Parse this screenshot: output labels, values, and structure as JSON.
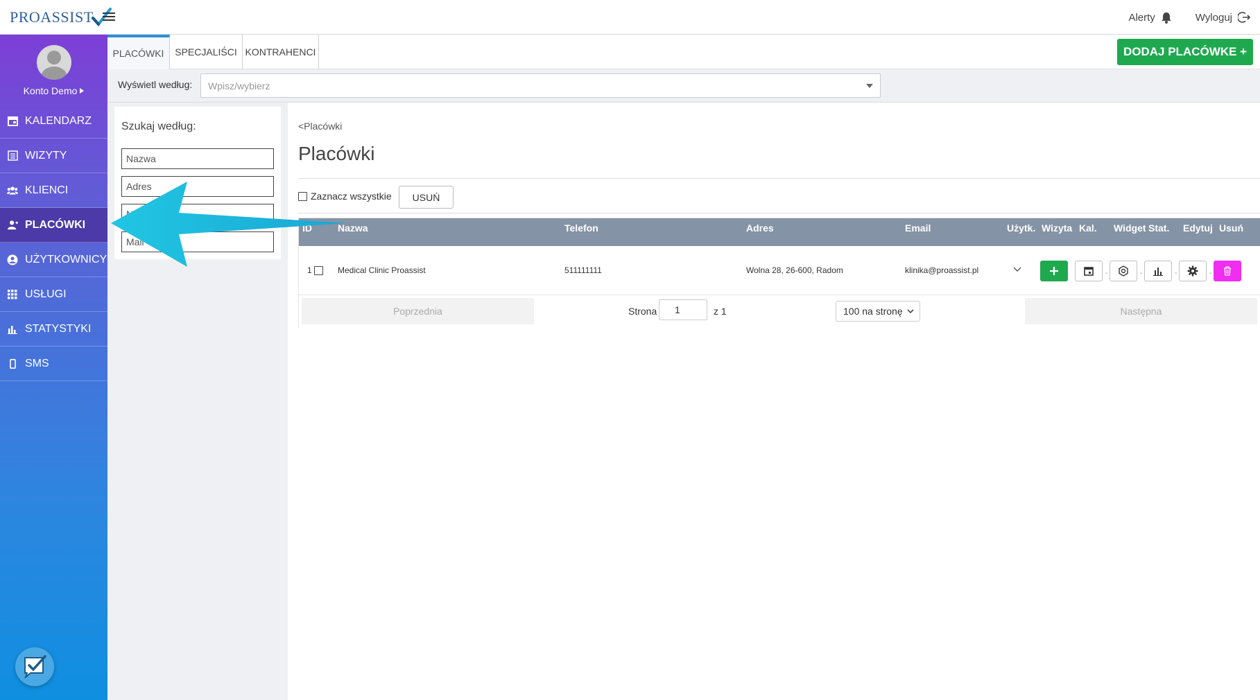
{
  "topbar": {
    "logo_text": "PROASSIST",
    "alerts_label": "Alerty",
    "logout_label": "Wyloguj"
  },
  "sidebar": {
    "profile_name": "Konto Demo",
    "items": [
      {
        "label": "KALENDARZ",
        "icon": "calendar-icon"
      },
      {
        "label": "WIZYTY",
        "icon": "list-icon"
      },
      {
        "label": "KLIENCI",
        "icon": "users-icon"
      },
      {
        "label": "PLACÓWKI",
        "icon": "user-icon",
        "active": true
      },
      {
        "label": "UŻYTKOWNICY",
        "icon": "user-circle-icon"
      },
      {
        "label": "USŁUGI",
        "icon": "grid-icon"
      },
      {
        "label": "STATYSTYKI",
        "icon": "chart-icon"
      },
      {
        "label": "SMS",
        "icon": "phone-icon"
      }
    ]
  },
  "tabs": [
    {
      "label": "PLACÓWKI",
      "active": true
    },
    {
      "label": "SPECJALIŚCI"
    },
    {
      "label": "KONTRAHENCI"
    }
  ],
  "add_button_label": "DODAJ PLACÓWKE +",
  "filter": {
    "label": "Wyświetl według:",
    "placeholder": "Wpisz/wybierz"
  },
  "search": {
    "title": "Szukaj według:",
    "fields": [
      "Nazwa",
      "Adres",
      "Nr",
      "Mail"
    ]
  },
  "main": {
    "breadcrumb": "<Placówki",
    "title": "Placówki",
    "select_all_label": "Zaznacz wszystkie",
    "delete_label": "USUŃ",
    "columns": [
      "ID",
      "Nazwa",
      "Telefon",
      "Adres",
      "Email",
      "Użytk.",
      "Wizyta",
      "Kal.",
      "Widget",
      "Stat.",
      "Edytuj",
      "Usuń"
    ],
    "rows": [
      {
        "id": "1",
        "name": "Medical Clinic Proassist",
        "phone": "511111111",
        "address": "Wolna 28, 26-600, Radom",
        "email": "klinika@proassist.pl"
      }
    ],
    "pager": {
      "prev_label": "Poprzednia",
      "page_label": "Strona",
      "page_value": "1",
      "of_label": "z 1",
      "per_page": "100 na stronę",
      "next_label": "Następna"
    }
  },
  "colors": {
    "accent_green": "#1fa94f",
    "delete_pink": "#f02df0",
    "active_tab_border": "#2c8ed6",
    "table_header": "#8593a6",
    "arrow": "#22c1e0"
  }
}
